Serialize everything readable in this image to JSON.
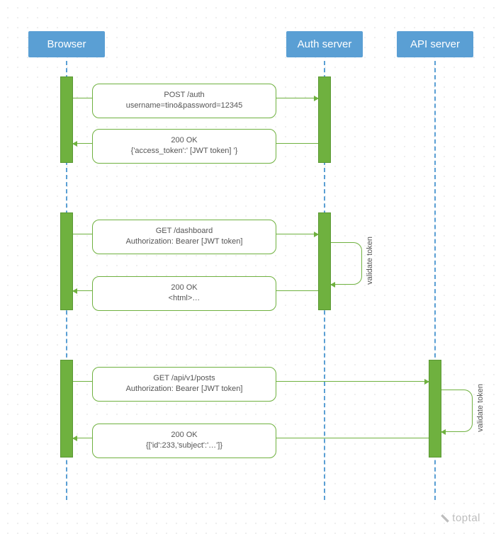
{
  "actors": {
    "browser": "Browser",
    "auth": "Auth server",
    "api": "API server"
  },
  "messages": {
    "m1l1": "POST /auth",
    "m1l2": "username=tino&password=12345",
    "m2l1": "200 OK",
    "m2l2": "{'access_token':' [JWT token] '}",
    "m3l1": "GET /dashboard",
    "m3l2": "Authorization: Bearer [JWT token]",
    "m4l1": "200 OK",
    "m4l2": "<html>…",
    "m5l1": "GET /api/v1/posts",
    "m5l2": "Authorization: Bearer [JWT token]",
    "m6l1": "200 OK",
    "m6l2": "{['id':233,'subject':'…']}"
  },
  "loops": {
    "validate1": "validate token",
    "validate2": "validate token"
  },
  "brand": "toptal",
  "colors": {
    "actor": "#5a9fd4",
    "bar": "#6fb13f"
  }
}
